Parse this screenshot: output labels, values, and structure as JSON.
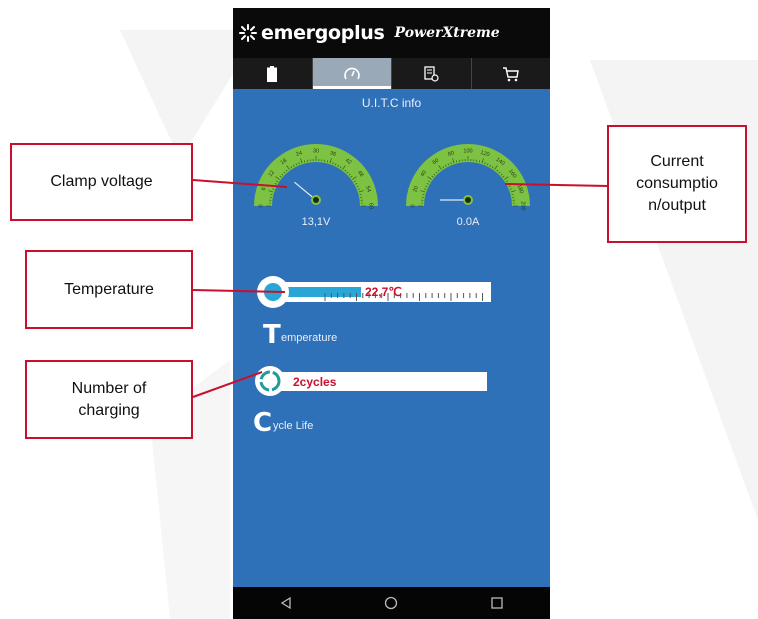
{
  "brand": {
    "name": "emergoplus",
    "product": "PowerXtreme"
  },
  "tabs": [
    {
      "icon": "battery-icon",
      "active": false
    },
    {
      "icon": "speedometer-icon",
      "active": true
    },
    {
      "icon": "document-settings-icon",
      "active": false
    },
    {
      "icon": "cart-icon",
      "active": false
    }
  ],
  "section_title": "U.I.T.C info",
  "voltage_gauge": {
    "value_text": "13,1V",
    "ticks": [
      "0",
      "6",
      "12",
      "18",
      "24",
      "30",
      "36",
      "42",
      "48",
      "54",
      "60"
    ],
    "needle_fraction": 0.22
  },
  "current_gauge": {
    "value_text": "0.0A",
    "ticks": [
      "0",
      "20",
      "40",
      "60",
      "80",
      "100",
      "120",
      "140",
      "160",
      "180",
      "200"
    ],
    "needle_fraction": 0.0
  },
  "temperature": {
    "value_text": "22,7℃",
    "label_initial": "T",
    "label_rest": "emperature",
    "fill_fraction": 0.36
  },
  "cycles": {
    "value_text": "2cycles",
    "label_initial": "C",
    "label_rest": "ycle Life"
  },
  "callouts": {
    "clamp": "Clamp voltage",
    "current": "Current consumptio n/output",
    "temperature": "Temperature",
    "charging": "Number of charging"
  },
  "colors": {
    "accent_red": "#c8102e",
    "app_blue": "#2f71b8",
    "gauge_green": "#7dc242"
  }
}
